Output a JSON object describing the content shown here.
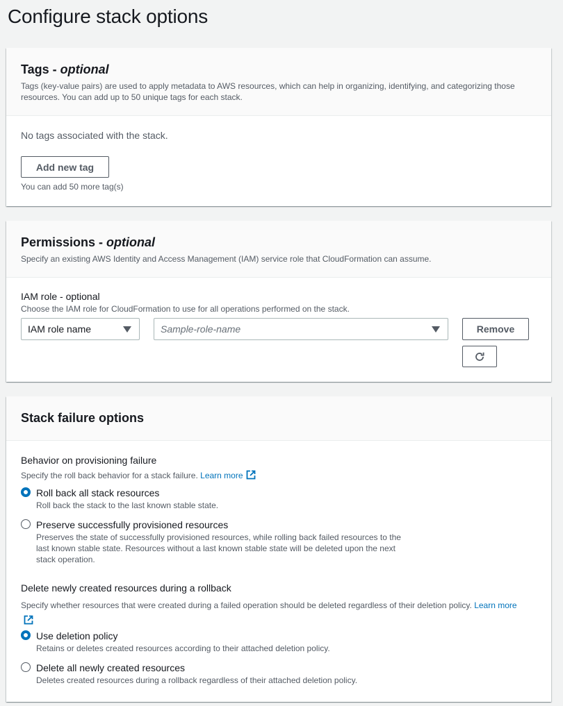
{
  "page": {
    "title": "Configure stack options"
  },
  "tags": {
    "title": "Tags - ",
    "title_suffix": "optional",
    "description": "Tags (key-value pairs) are used to apply metadata to AWS resources, which can help in organizing, identifying, and categorizing those resources. You can add up to 50 unique tags for each stack.",
    "empty_text": "No tags associated with the stack.",
    "add_button": "Add new tag",
    "hint": "You can add 50 more tag(s)"
  },
  "permissions": {
    "title": "Permissions - ",
    "title_suffix": "optional",
    "description": "Specify an existing AWS Identity and Access Management (IAM) service role that CloudFormation can assume.",
    "iam_label": "IAM role - optional",
    "iam_desc": "Choose the IAM role for CloudFormation to use for all operations performed on the stack.",
    "role_type_selected": "IAM role name",
    "role_name_placeholder": "Sample-role-name",
    "remove_button": "Remove"
  },
  "failure": {
    "title": "Stack failure options",
    "behavior_label": "Behavior on provisioning failure",
    "behavior_desc": "Specify the roll back behavior for a stack failure.",
    "learn_more": "Learn more",
    "options": [
      {
        "label": "Roll back all stack resources",
        "desc": "Roll back the stack to the last known stable state.",
        "checked": true
      },
      {
        "label": "Preserve successfully provisioned resources",
        "desc": "Preserves the state of successfully provisioned resources, while rolling back failed resources to the last known stable state. Resources without a last known stable state will be deleted upon the next stack operation.",
        "checked": false
      }
    ],
    "delete_label": "Delete newly created resources during a rollback",
    "delete_desc": "Specify whether resources that were created during a failed operation should be deleted regardless of their deletion policy.",
    "delete_learn_1": "Learn",
    "delete_learn_2": "more",
    "delete_options": [
      {
        "label": "Use deletion policy",
        "desc": "Retains or deletes created resources according to their attached deletion policy.",
        "checked": true
      },
      {
        "label": "Delete all newly created resources",
        "desc": "Deletes created resources during a rollback regardless of their attached deletion policy.",
        "checked": false
      }
    ]
  },
  "icons": {
    "external_link": "external-link-icon",
    "refresh": "refresh-icon",
    "caret": "caret-down-icon"
  },
  "colors": {
    "accent": "#0073bb",
    "text": "#16191f",
    "muted": "#545b64"
  }
}
